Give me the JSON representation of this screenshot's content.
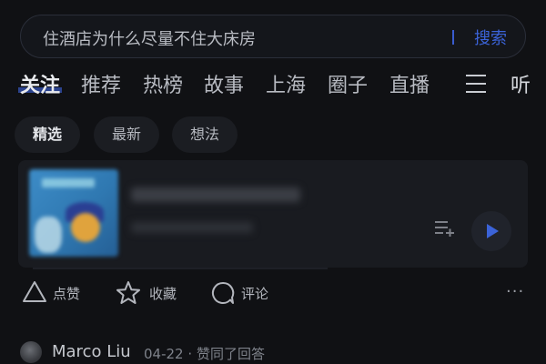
{
  "search": {
    "query": "住酒店为什么尽量不住大床房",
    "button_label": "搜索"
  },
  "tabs": [
    "关注",
    "推荐",
    "热榜",
    "故事",
    "上海",
    "圈子",
    "直播"
  ],
  "active_tab": "关注",
  "listen_label": "听",
  "chips": [
    "精选",
    "最新",
    "想法"
  ],
  "actions": {
    "like_label": "点赞",
    "collect_label": "收藏",
    "comment_label": "评论"
  },
  "activity": {
    "username": "Marco Liu",
    "date": "04-22",
    "separator": "·",
    "action": "赞同了回答"
  },
  "colors": {
    "background": "#101114",
    "accent": "#3b63d8"
  },
  "icons": [
    "menu-icon",
    "add-to-queue-icon",
    "play-icon",
    "like-icon",
    "star-icon",
    "comment-icon",
    "more-icon"
  ]
}
